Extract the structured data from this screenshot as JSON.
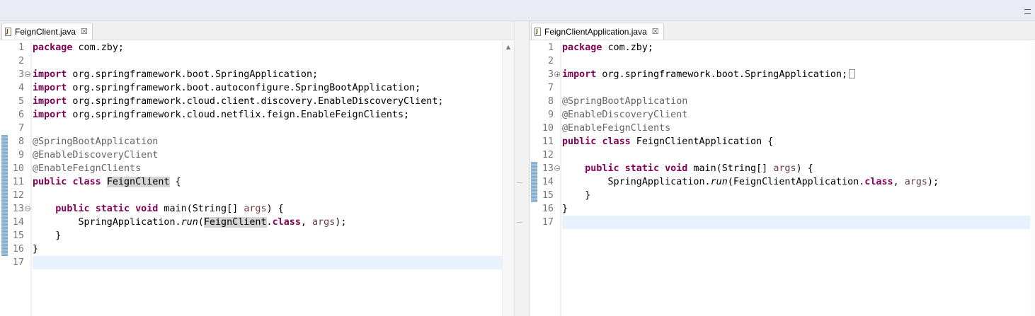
{
  "left_editor": {
    "tab_label": "FeignClient.java",
    "file_icon_glyph": "J",
    "close_glyph": "☒",
    "lines": [
      {
        "n": "1",
        "parts": [
          {
            "t": "package",
            "c": "kw"
          },
          {
            "t": " com.zby;"
          }
        ]
      },
      {
        "n": "2",
        "parts": []
      },
      {
        "n": "3",
        "fold": "⊖",
        "parts": [
          {
            "t": "import",
            "c": "kw"
          },
          {
            "t": " org.springframework.boot.SpringApplication;"
          }
        ]
      },
      {
        "n": "4",
        "parts": [
          {
            "t": "import",
            "c": "kw"
          },
          {
            "t": " org.springframework.boot.autoconfigure.SpringBootApplication;"
          }
        ]
      },
      {
        "n": "5",
        "parts": [
          {
            "t": "import",
            "c": "kw"
          },
          {
            "t": " org.springframework.cloud.client.discovery.EnableDiscoveryClient;"
          }
        ]
      },
      {
        "n": "6",
        "parts": [
          {
            "t": "import",
            "c": "kw"
          },
          {
            "t": " org.springframework.cloud.netflix.feign.EnableFeignClients;"
          }
        ]
      },
      {
        "n": "7",
        "parts": []
      },
      {
        "n": "8",
        "parts": [
          {
            "t": "@SpringBootApplication",
            "c": "ann"
          }
        ]
      },
      {
        "n": "9",
        "parts": [
          {
            "t": "@EnableDiscoveryClient",
            "c": "ann"
          }
        ]
      },
      {
        "n": "10",
        "parts": [
          {
            "t": "@EnableFeignClients",
            "c": "ann"
          }
        ]
      },
      {
        "n": "11",
        "parts": [
          {
            "t": "public",
            "c": "kw"
          },
          {
            "t": " "
          },
          {
            "t": "class",
            "c": "kw"
          },
          {
            "t": " "
          },
          {
            "t": "FeignClient",
            "c": "occ"
          },
          {
            "t": " {"
          }
        ]
      },
      {
        "n": "12",
        "parts": []
      },
      {
        "n": "13",
        "fold": "⊖",
        "parts": [
          {
            "t": "    "
          },
          {
            "t": "public",
            "c": "kw"
          },
          {
            "t": " "
          },
          {
            "t": "static",
            "c": "kw"
          },
          {
            "t": " "
          },
          {
            "t": "void",
            "c": "kw"
          },
          {
            "t": " main(String[] "
          },
          {
            "t": "args",
            "c": "param"
          },
          {
            "t": ") {"
          }
        ]
      },
      {
        "n": "14",
        "parts": [
          {
            "t": "        SpringApplication."
          },
          {
            "t": "run",
            "c": "ital"
          },
          {
            "t": "("
          },
          {
            "t": "FeignClient",
            "c": "occ"
          },
          {
            "t": "."
          },
          {
            "t": "class",
            "c": "kw"
          },
          {
            "t": ", "
          },
          {
            "t": "args",
            "c": "param"
          },
          {
            "t": ");"
          }
        ]
      },
      {
        "n": "15",
        "parts": [
          {
            "t": "    }"
          }
        ]
      },
      {
        "n": "16",
        "parts": [
          {
            "t": "}"
          }
        ]
      },
      {
        "n": "17",
        "current": true,
        "parts": []
      }
    ]
  },
  "right_editor": {
    "tab_label": "FeignClientApplication.java",
    "file_icon_glyph": "J",
    "close_glyph": "☒",
    "lines": [
      {
        "n": "1",
        "parts": [
          {
            "t": "package",
            "c": "kw"
          },
          {
            "t": " com.zby;"
          }
        ]
      },
      {
        "n": "2",
        "parts": []
      },
      {
        "n": "3",
        "fold": "⊕",
        "collapsed": true,
        "parts": [
          {
            "t": "import",
            "c": "kw"
          },
          {
            "t": " org.springframework.boot.SpringApplication;"
          }
        ]
      },
      {
        "n": "7",
        "parts": []
      },
      {
        "n": "8",
        "parts": [
          {
            "t": "@SpringBootApplication",
            "c": "ann"
          }
        ]
      },
      {
        "n": "9",
        "parts": [
          {
            "t": "@EnableDiscoveryClient",
            "c": "ann"
          }
        ]
      },
      {
        "n": "10",
        "parts": [
          {
            "t": "@EnableFeignClients",
            "c": "ann"
          }
        ]
      },
      {
        "n": "11",
        "parts": [
          {
            "t": "public",
            "c": "kw"
          },
          {
            "t": " "
          },
          {
            "t": "class",
            "c": "kw"
          },
          {
            "t": " FeignClientApplication {"
          }
        ]
      },
      {
        "n": "12",
        "parts": []
      },
      {
        "n": "13",
        "fold": "⊖",
        "parts": [
          {
            "t": "    "
          },
          {
            "t": "public",
            "c": "kw"
          },
          {
            "t": " "
          },
          {
            "t": "static",
            "c": "kw"
          },
          {
            "t": " "
          },
          {
            "t": "void",
            "c": "kw"
          },
          {
            "t": " main(String[] "
          },
          {
            "t": "args",
            "c": "param"
          },
          {
            "t": ") {"
          }
        ]
      },
      {
        "n": "14",
        "parts": [
          {
            "t": "        SpringApplication."
          },
          {
            "t": "run",
            "c": "ital"
          },
          {
            "t": "(FeignClientApplication."
          },
          {
            "t": "class",
            "c": "kw"
          },
          {
            "t": ", "
          },
          {
            "t": "args",
            "c": "param"
          },
          {
            "t": ");"
          }
        ]
      },
      {
        "n": "15",
        "parts": [
          {
            "t": "    }"
          }
        ]
      },
      {
        "n": "16",
        "parts": [
          {
            "t": "}"
          }
        ]
      },
      {
        "n": "17",
        "current": true,
        "parts": []
      }
    ]
  },
  "colors": {
    "keyword": "#7f0055",
    "annotation": "#646464",
    "parameter": "#6a3e3e",
    "line_number": "#787878",
    "current_line": "#e8f2fe",
    "occurrence_highlight": "#d4d4d4",
    "change_bar": "#7fa9c9"
  },
  "icons": {
    "window": "minimize-icon",
    "tab_file": "java-file-icon",
    "tab_close": "close-icon",
    "fold_expanded": "fold-collapse-icon",
    "fold_collapsed": "fold-expand-icon",
    "scroll": "scroll-up-arrow-icon"
  }
}
